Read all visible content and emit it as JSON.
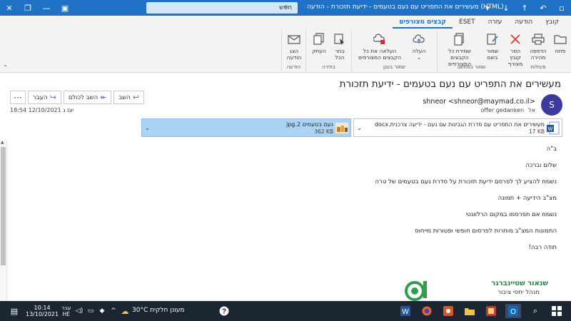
{
  "titlebar": {
    "search_placeholder": "חפש",
    "window_title": "מעשירים את התפריט עם נעם בטעמים - ידיעת תזכורת - הודעה (HTML)",
    "undo_icon": "undo-icon",
    "colors": {
      "bar": "#1f72c6"
    }
  },
  "ribbon": {
    "tabs": [
      {
        "label": "קובץ",
        "active": false
      },
      {
        "label": "הודעה",
        "active": false
      },
      {
        "label": "עזרה",
        "active": false
      },
      {
        "label": "ESET",
        "active": false
      },
      {
        "label": "קבצים מצורפים",
        "active": true
      }
    ],
    "groups": {
      "actions": {
        "label": "פעולות",
        "open": "פתח",
        "print": "הדפסה\nמהירה",
        "remove": "הסר קובץ\nמצורף",
        "save_as": "שמור\nבשם",
        "save_all": "שמירת כל\nהקבצים המצורפים"
      },
      "save_to_computer": {
        "label": "שמור במחשב"
      },
      "save_to_cloud": {
        "label": "שמור בענן",
        "upload": "העלה",
        "upload_all": "העלאה את כל\nהקבצים המצורפים"
      },
      "selection": {
        "label": "בחירה",
        "copy": "העתק",
        "select_all": "בחר\nהכל"
      },
      "message": {
        "label": "הודעה",
        "show_message": "הצג\nהודעה"
      }
    }
  },
  "message": {
    "subject": "מעשירים את התפריט עם נעם בטעמים - ידיעת תזכורת",
    "sender": "shneor <shneor@maymad.co.il>",
    "to_label": "אל",
    "to_value": "offer gedanken",
    "date": "יום ג 12/10/2021 18:54",
    "avatar_letter": "S",
    "reply": "השב",
    "reply_all": "השב לכולם",
    "forward": "העבר",
    "more": "···"
  },
  "attachments": [
    {
      "name": "מעשירים את התפריט עם סדרת הגבינות עם נעם - ידיעה צרכנית.docx",
      "size": "17 KB",
      "icon": "word-doc-icon",
      "selected": false
    },
    {
      "name": "נעם בטעמים 2.jpg",
      "size": "362 KB",
      "icon": "image-icon",
      "selected": true
    }
  ],
  "body": [
    "ב\"ה",
    "שלום וברכה",
    "נשמח להציע לך לפרסם ידיעת תזכורת על סדרת נעם בטעמים של טרה",
    "מצ\"ב הידיעה + תמונה",
    "נשמח אם תפרסמו במקום הרלוונטי",
    "התמונות המצ\"ב מותרות לפרסום חופשי ופטורות מייחוס",
    "תודה רבה!"
  ],
  "signature": {
    "name": "שנאור שטיינברגר",
    "role": "מנהל יחסי ציבור",
    "name_color": "#1d8a3e"
  },
  "taskbar": {
    "time": "10:14",
    "date": "13/10/2021",
    "lang_top": "עבר",
    "lang_bottom": "HE",
    "weather": "30°C מעונן חלקית"
  }
}
